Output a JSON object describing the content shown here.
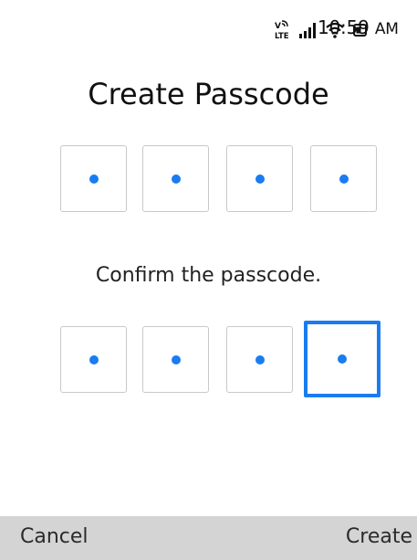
{
  "status_bar": {
    "time": "10:59",
    "ampm": "AM",
    "icons": [
      "volte-icon",
      "signal-icon",
      "wifi-icon",
      "battery-icon"
    ]
  },
  "title": "Create Passcode",
  "passcode": {
    "length": 4,
    "entered_count": 4,
    "mask_char": "•"
  },
  "confirm": {
    "label": "Confirm the passcode.",
    "length": 4,
    "entered_count": 4,
    "focused_index": 3
  },
  "softkeys": {
    "left": "Cancel",
    "center": "",
    "right": "Create"
  },
  "colors": {
    "accent": "#1a7cf0",
    "box_border": "#c9c9c9",
    "softkey_bar": "#d4d4d4",
    "text": "#111111"
  }
}
